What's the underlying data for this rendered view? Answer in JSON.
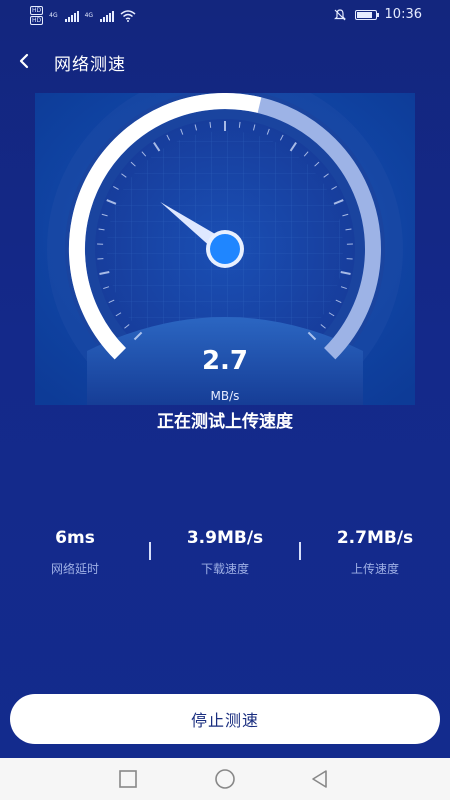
{
  "status_bar": {
    "time": "10:36",
    "network_1": "4G",
    "network_2": "4G",
    "hd_badge_1": "HD",
    "hd_badge_2": "HD",
    "battery_level": 0.85,
    "icons": [
      "signal-icon",
      "wifi-icon",
      "mute-icon",
      "battery-icon"
    ]
  },
  "header": {
    "title": "网络测速",
    "back_icon": "chevron-left-icon"
  },
  "gauge": {
    "value": "2.7",
    "unit": "MB/s",
    "needle_fraction": 0.3,
    "progress_fraction": 0.55
  },
  "status_text": "正在测试上传速度",
  "stats": [
    {
      "value": "6ms",
      "label": "网络延时"
    },
    {
      "value": "3.9MB/s",
      "label": "下载速度"
    },
    {
      "value": "2.7MB/s",
      "label": "上传速度"
    }
  ],
  "stop_button": {
    "label": "停止测速"
  },
  "nav_bar": {
    "items": [
      "recents-square-icon",
      "home-circle-icon",
      "back-triangle-icon"
    ]
  },
  "colors": {
    "background": "#13277f",
    "gauge_panel": "#0f3f9c",
    "accent": "#4aa3ff",
    "button_text": "#1a2e7f"
  }
}
